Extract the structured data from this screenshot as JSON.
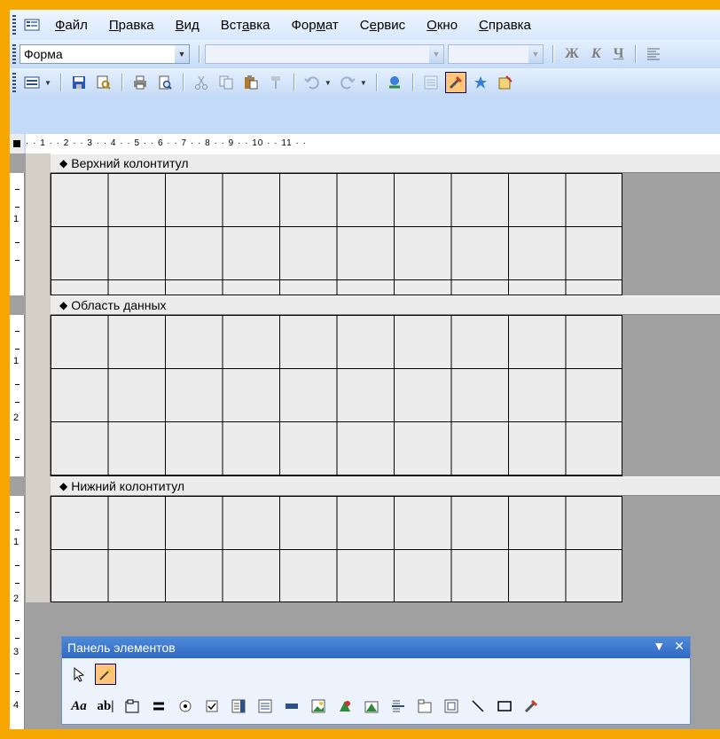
{
  "menu": {
    "items": [
      {
        "pre": "",
        "ul": "Ф",
        "post": "айл"
      },
      {
        "pre": "",
        "ul": "П",
        "post": "равка"
      },
      {
        "pre": "",
        "ul": "В",
        "post": "ид"
      },
      {
        "pre": "Вст",
        "ul": "а",
        "post": "вка"
      },
      {
        "pre": "Фор",
        "ul": "м",
        "post": "ат"
      },
      {
        "pre": "С",
        "ul": "е",
        "post": "рвис"
      },
      {
        "pre": "",
        "ul": "О",
        "post": "кно"
      },
      {
        "pre": "",
        "ul": "С",
        "post": "правка"
      }
    ]
  },
  "format_toolbar": {
    "object_combo_value": "Форма",
    "font_combo_value": "",
    "size_combo_value": "",
    "bold_label": "Ж",
    "italic_label": "К",
    "underline_label": "Ч"
  },
  "standard_toolbar": {
    "icons": [
      "view-form-icon",
      "save-icon",
      "search-icon",
      "print-icon",
      "print-preview-icon",
      "cut-icon",
      "copy-icon",
      "paste-icon",
      "format-painter-icon",
      "undo-icon",
      "redo-icon",
      "hyperlink-icon",
      "field-list-icon",
      "toolbox-icon",
      "autoformat-icon",
      "code-icon"
    ]
  },
  "ruler": {
    "text": "· · 1 · · 2 · · 3 · · 4 · · 5 · · 6 · · 7 · · 8 · · 9 · · 10 · · 11 · ·"
  },
  "sections": {
    "header": "Верхний колонтитул",
    "detail": "Область данных",
    "footer": "Нижний колонтитул"
  },
  "vruler_numbers": {
    "header": [
      "1"
    ],
    "detail": [
      "1",
      "2"
    ],
    "footer": [
      "1",
      "2",
      "3",
      "4"
    ]
  },
  "toolbox": {
    "title": "Панель элементов",
    "row1": [
      "select-objects-icon",
      "control-wizards-icon"
    ],
    "row2": [
      "label-icon",
      "textbox-icon",
      "option-group-icon",
      "toggle-button-icon",
      "option-button-icon",
      "checkbox-icon",
      "combobox-icon",
      "listbox-icon",
      "command-button-icon",
      "image-icon",
      "unbound-object-frame-icon",
      "bound-object-frame-icon",
      "page-break-icon",
      "tab-control-icon",
      "subform-icon",
      "line-icon",
      "rectangle-icon",
      "more-controls-icon"
    ],
    "label_text": "Aa",
    "textbox_text": "ab|"
  }
}
